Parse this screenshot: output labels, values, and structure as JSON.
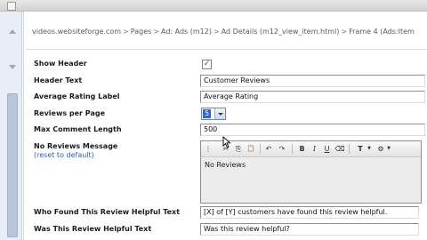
{
  "topbar": {
    "text": "videos.websiteforge.com/... (partial)"
  },
  "breadcrumb": [
    "videos.websiteforge.com",
    "Pages",
    "Ad: Ads (m12)",
    "Ad Details (m12_view_item.html)",
    "Frame 4 (Ads:Item"
  ],
  "form": {
    "show_header": {
      "label": "Show Header",
      "checked": true,
      "check_glyph": "✓"
    },
    "header_text": {
      "label": "Header Text",
      "value": "Customer Reviews"
    },
    "average_rating_label": {
      "label": "Average Rating Label",
      "value": "Average Rating"
    },
    "reviews_per_page": {
      "label": "Reviews per Page",
      "value": "5"
    },
    "max_comment_length": {
      "label": "Max Comment Length",
      "value": "500"
    },
    "no_reviews_message": {
      "label": "No Reviews Message",
      "reset_link": "(reset to default)",
      "value": "No Reviews"
    },
    "who_found_helpful": {
      "label": "Who Found This Review Helpful Text",
      "value": "[X] of [Y] customers have found this review helpful."
    },
    "was_helpful": {
      "label": "Was This Review Helpful Text",
      "value": "Was this review helpful?"
    }
  },
  "toolbar": {
    "cut_icon": "✂",
    "copy_icon": "⎘",
    "paste_icon": "📋",
    "undo_icon": "↶",
    "redo_icon": "↷",
    "bold_label": "B",
    "italic_label": "I",
    "underline_label": "U",
    "eraser_icon": "⌫",
    "text_format_icon": "T",
    "spellcheck_icon": "⚙"
  }
}
